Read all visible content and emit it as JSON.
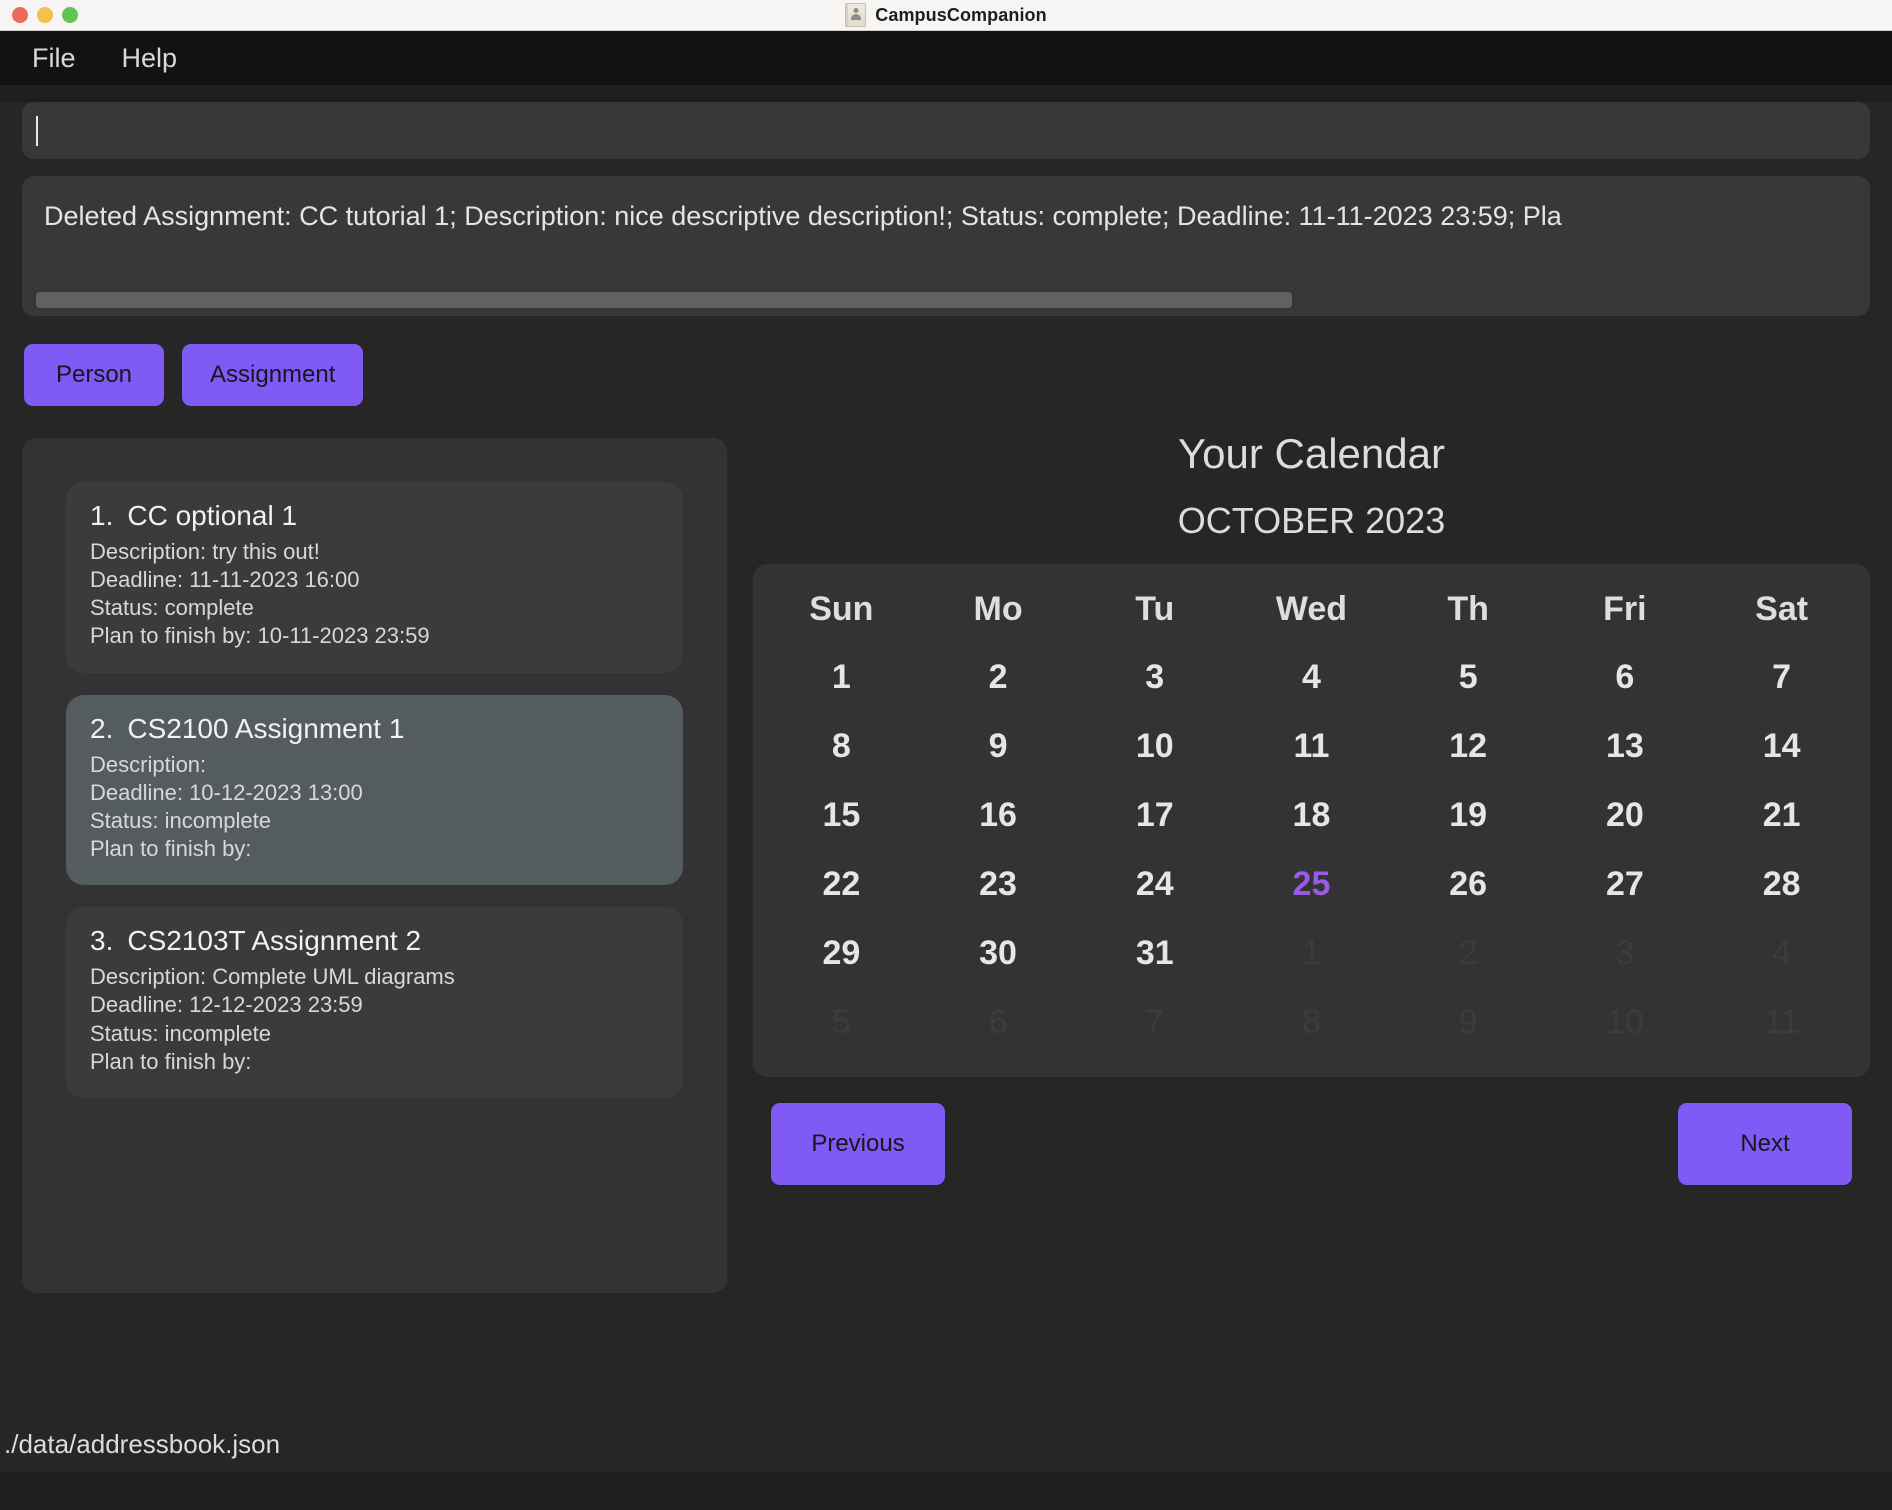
{
  "window": {
    "title": "CampusCompanion",
    "icon": "contact-card-icon",
    "traffic_lights": [
      "close",
      "minimize",
      "maximize"
    ]
  },
  "menubar": {
    "items": [
      {
        "label": "File"
      },
      {
        "label": "Help"
      }
    ]
  },
  "command_input": {
    "value": "",
    "placeholder": ""
  },
  "result_display": {
    "text": "Deleted Assignment: CC tutorial 1; Description: nice descriptive description!; Status: complete; Deadline: 11-11-2023 23:59; Pla",
    "scroll_thumb_percent": 69
  },
  "filter_buttons": [
    {
      "label": "Person",
      "name": "person-button"
    },
    {
      "label": "Assignment",
      "name": "assignment-button"
    }
  ],
  "assignment_list": {
    "items": [
      {
        "index": "1.",
        "title": "CC optional 1",
        "description": "Description: try this out!",
        "deadline": "Deadline: 11-11-2023 16:00",
        "status": "Status: complete",
        "plan": "Plan to finish by: 10-11-2023 23:59",
        "selected": false
      },
      {
        "index": "2.",
        "title": "CS2100 Assignment 1",
        "description": "Description:",
        "deadline": "Deadline: 10-12-2023 13:00",
        "status": "Status: incomplete",
        "plan": "Plan to finish by:",
        "selected": true
      },
      {
        "index": "3.",
        "title": "CS2103T Assignment 2",
        "description": "Description: Complete UML diagrams",
        "deadline": "Deadline: 12-12-2023 23:59",
        "status": "Status: incomplete",
        "plan": "Plan to finish by:",
        "selected": false
      }
    ]
  },
  "calendar": {
    "title": "Your Calendar",
    "month_label": "OCTOBER 2023",
    "weekday_headers": [
      "Sun",
      "Mo",
      "Tu",
      "Wed",
      "Th",
      "Fri",
      "Sat"
    ],
    "today": 25,
    "today_color": "#9b59e8",
    "weeks": [
      [
        {
          "day": "1",
          "muted": false
        },
        {
          "day": "2",
          "muted": false
        },
        {
          "day": "3",
          "muted": false
        },
        {
          "day": "4",
          "muted": false
        },
        {
          "day": "5",
          "muted": false
        },
        {
          "day": "6",
          "muted": false
        },
        {
          "day": "7",
          "muted": false
        }
      ],
      [
        {
          "day": "8",
          "muted": false
        },
        {
          "day": "9",
          "muted": false
        },
        {
          "day": "10",
          "muted": false
        },
        {
          "day": "11",
          "muted": false
        },
        {
          "day": "12",
          "muted": false
        },
        {
          "day": "13",
          "muted": false
        },
        {
          "day": "14",
          "muted": false
        }
      ],
      [
        {
          "day": "15",
          "muted": false
        },
        {
          "day": "16",
          "muted": false
        },
        {
          "day": "17",
          "muted": false
        },
        {
          "day": "18",
          "muted": false
        },
        {
          "day": "19",
          "muted": false
        },
        {
          "day": "20",
          "muted": false
        },
        {
          "day": "21",
          "muted": false
        }
      ],
      [
        {
          "day": "22",
          "muted": false
        },
        {
          "day": "23",
          "muted": false
        },
        {
          "day": "24",
          "muted": false
        },
        {
          "day": "25",
          "muted": false,
          "today": true
        },
        {
          "day": "26",
          "muted": false
        },
        {
          "day": "27",
          "muted": false
        },
        {
          "day": "28",
          "muted": false
        }
      ],
      [
        {
          "day": "29",
          "muted": false
        },
        {
          "day": "30",
          "muted": false
        },
        {
          "day": "31",
          "muted": false
        },
        {
          "day": "1",
          "muted": true
        },
        {
          "day": "2",
          "muted": true
        },
        {
          "day": "3",
          "muted": true
        },
        {
          "day": "4",
          "muted": true
        }
      ],
      [
        {
          "day": "5",
          "muted": true
        },
        {
          "day": "6",
          "muted": true
        },
        {
          "day": "7",
          "muted": true
        },
        {
          "day": "8",
          "muted": true
        },
        {
          "day": "9",
          "muted": true
        },
        {
          "day": "10",
          "muted": true
        },
        {
          "day": "11",
          "muted": true
        }
      ]
    ],
    "previous_label": "Previous",
    "next_label": "Next"
  },
  "statusbar": {
    "path": "./data/addressbook.json"
  },
  "colors": {
    "accent_purple": "#7f5af5",
    "today_purple": "#9b59e8",
    "app_background": "#262626",
    "panel_background": "#333333",
    "card_background": "#3b3b3b",
    "card_selected_background": "#555c5f"
  }
}
